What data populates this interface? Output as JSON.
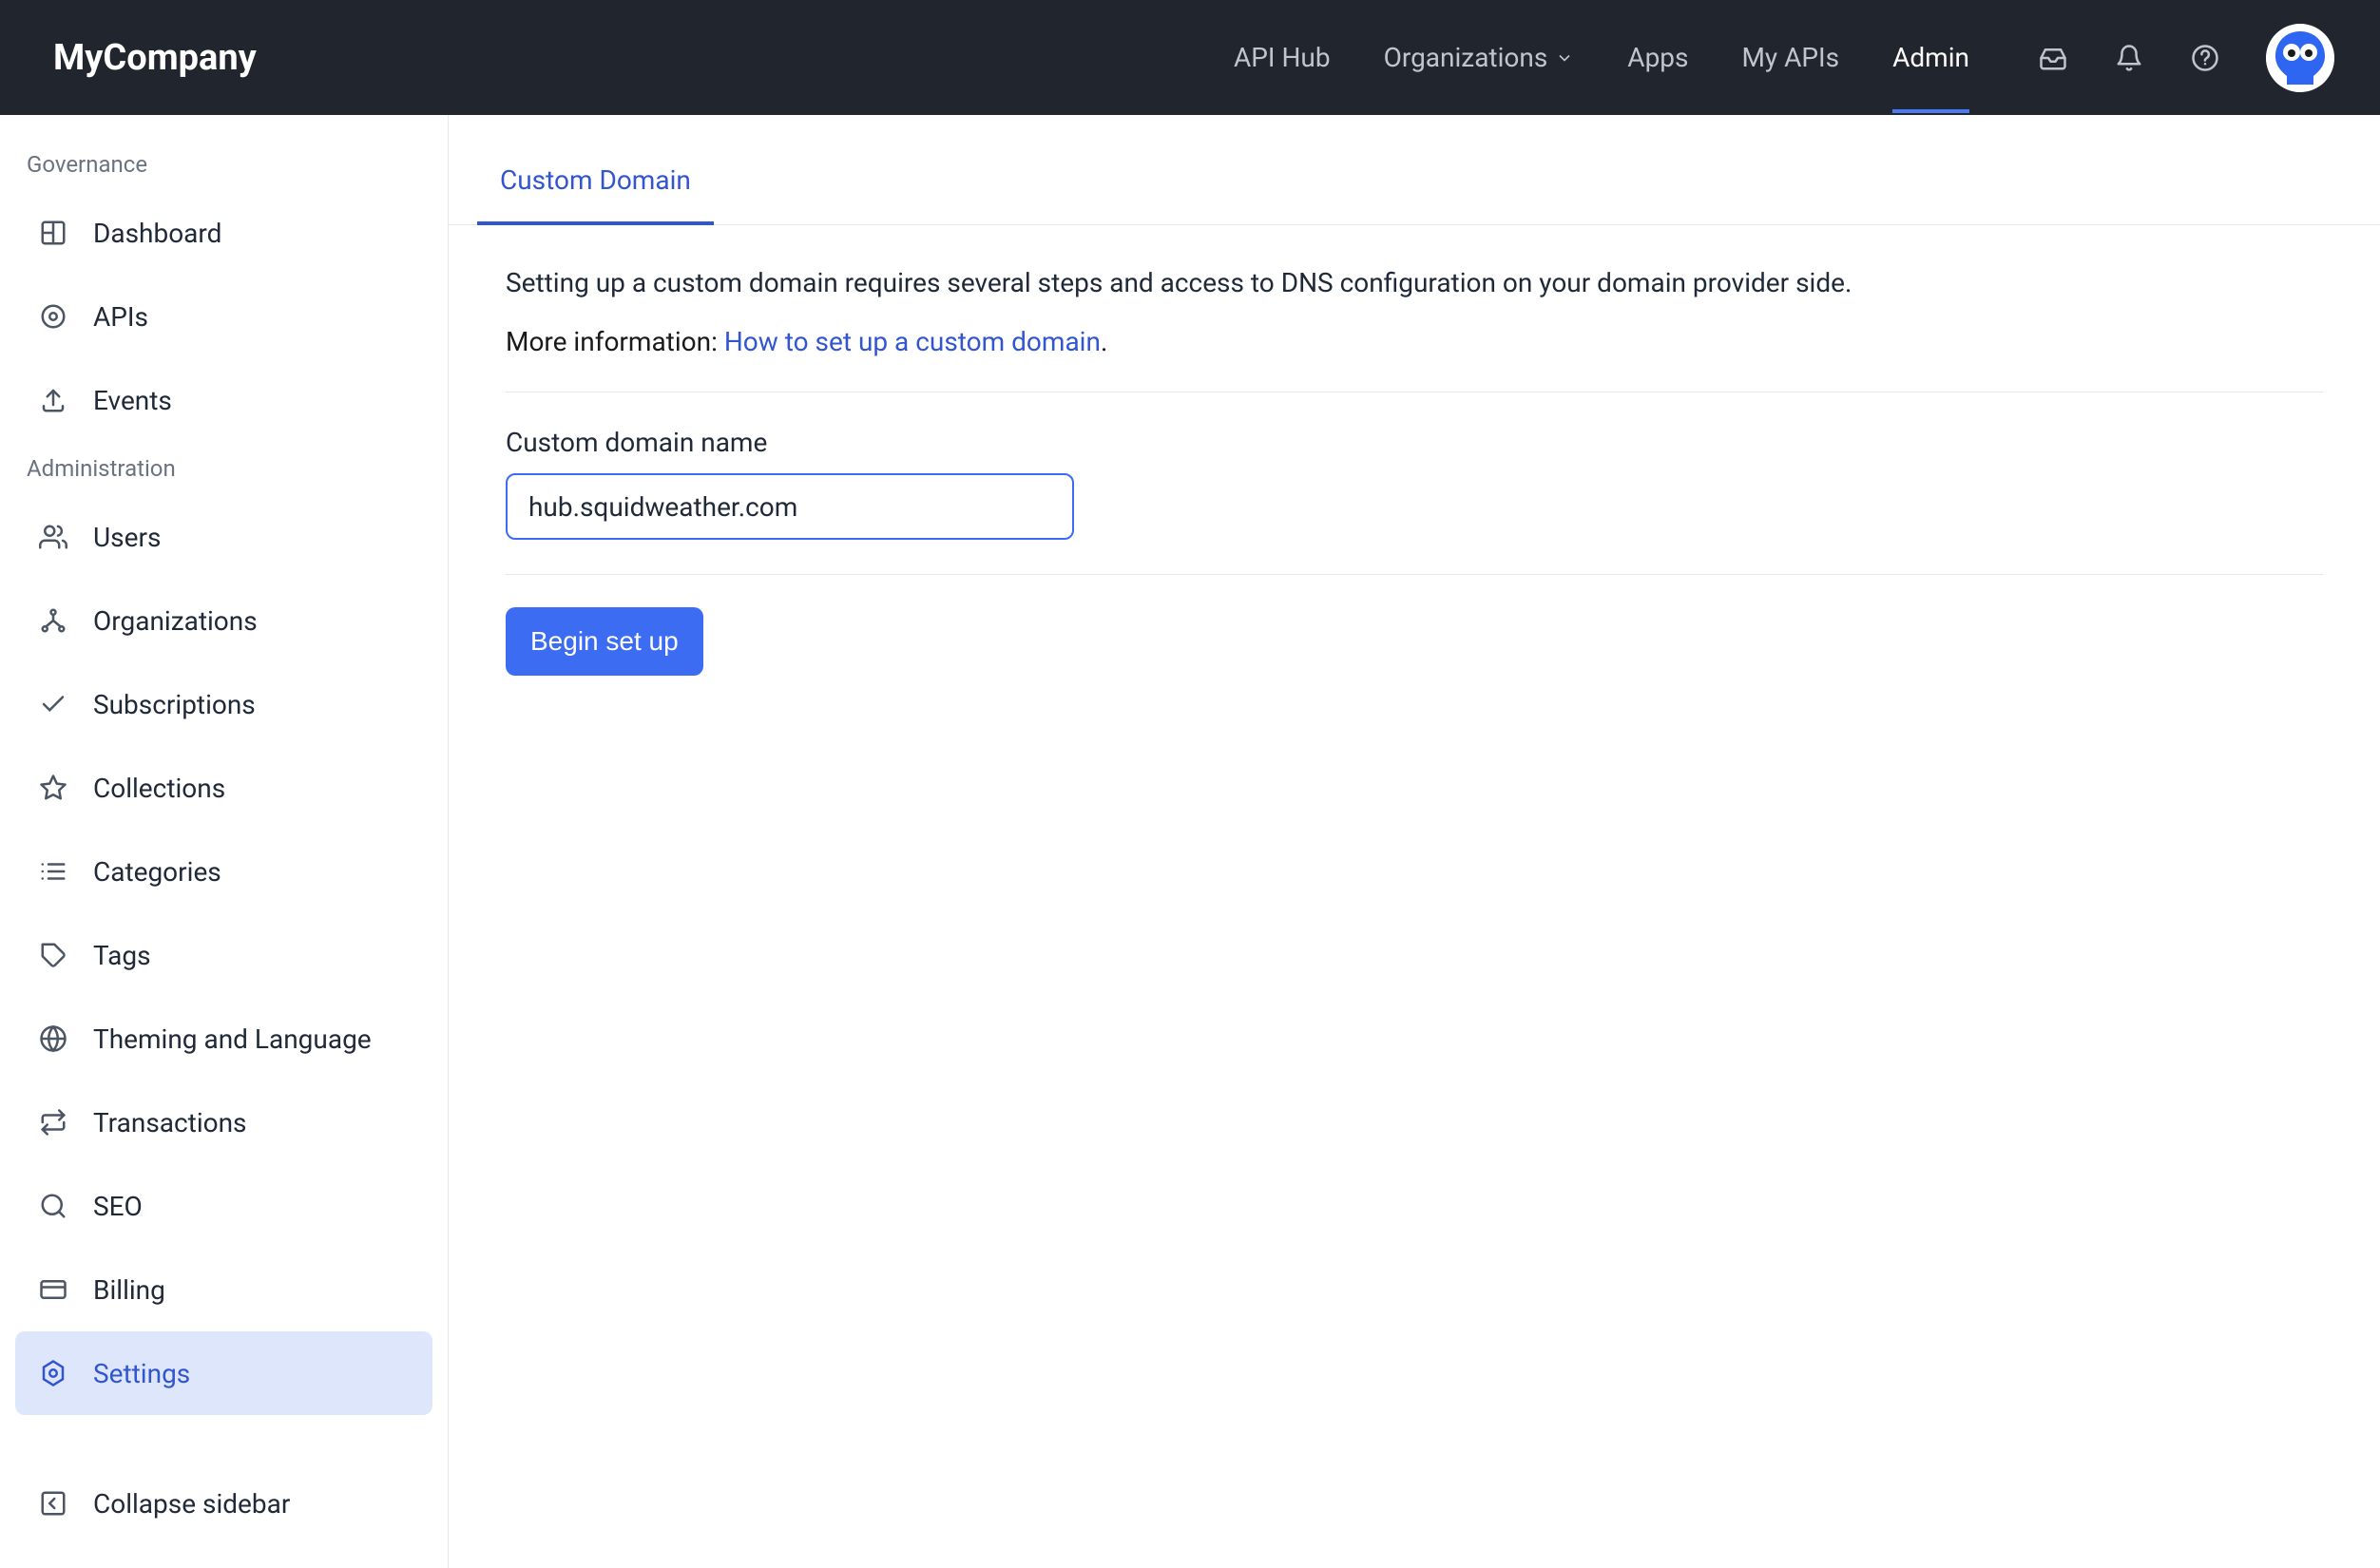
{
  "brand": "MyCompany",
  "topnav": {
    "api_hub": "API Hub",
    "organizations": "Organizations",
    "apps": "Apps",
    "my_apis": "My APIs",
    "admin": "Admin"
  },
  "sidebar": {
    "governance_label": "Governance",
    "administration_label": "Administration",
    "dashboard": "Dashboard",
    "apis": "APIs",
    "events": "Events",
    "users": "Users",
    "organizations": "Organizations",
    "subscriptions": "Subscriptions",
    "collections": "Collections",
    "categories": "Categories",
    "tags": "Tags",
    "theming": "Theming and Language",
    "transactions": "Transactions",
    "seo": "SEO",
    "billing": "Billing",
    "settings": "Settings",
    "collapse": "Collapse sidebar"
  },
  "tabs": {
    "custom_domain": "Custom Domain"
  },
  "content": {
    "intro": "Setting up a custom domain requires several steps and access to DNS configuration on your domain provider side.",
    "more_info_prefix": "More information: ",
    "more_info_link": "How to set up a custom domain",
    "more_info_suffix": ".",
    "field_label": "Custom domain name",
    "field_value": "hub.squidweather.com",
    "submit_label": "Begin set up"
  }
}
